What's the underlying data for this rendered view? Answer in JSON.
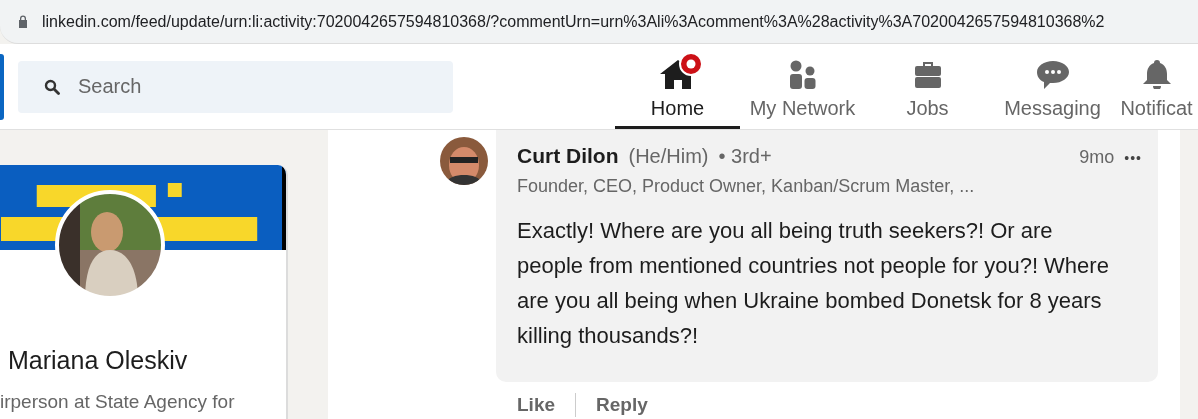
{
  "address_bar": {
    "url": "linkedin.com/feed/update/urn:li:activity:7020042657594810368/?commentUrn=urn%3Ali%3Acomment%3A%28activity%3A7020042657594810368%2"
  },
  "search": {
    "placeholder": "Search"
  },
  "nav": [
    {
      "kind": "home",
      "label": "Home",
      "selected": true,
      "badge": true
    },
    {
      "kind": "network",
      "label": "My Network",
      "selected": false,
      "badge": false
    },
    {
      "kind": "jobs",
      "label": "Jobs",
      "selected": false,
      "badge": false
    },
    {
      "kind": "messaging",
      "label": "Messaging",
      "selected": false,
      "badge": false
    },
    {
      "kind": "bell",
      "label": "Notificat",
      "selected": false,
      "badge": false
    }
  ],
  "profile_card": {
    "name": "Mariana Oleskiv",
    "headline": "irperson at State Agency for"
  },
  "comment": {
    "author": "Curt Dilon",
    "pronouns": "(He/Him)",
    "degree": "• 3rd+",
    "headline": "Founder, CEO, Product Owner, Kanban/Scrum Master, ...",
    "time": "9mo",
    "more": "•••",
    "text": "Exactly! Where are you all being truth seekers?! Or are people from mentioned countries not people for you?! Where are you all being when Ukraine bombed Donetsk for 8 years killing thousands?!",
    "actions": [
      "Like",
      "Reply"
    ]
  }
}
